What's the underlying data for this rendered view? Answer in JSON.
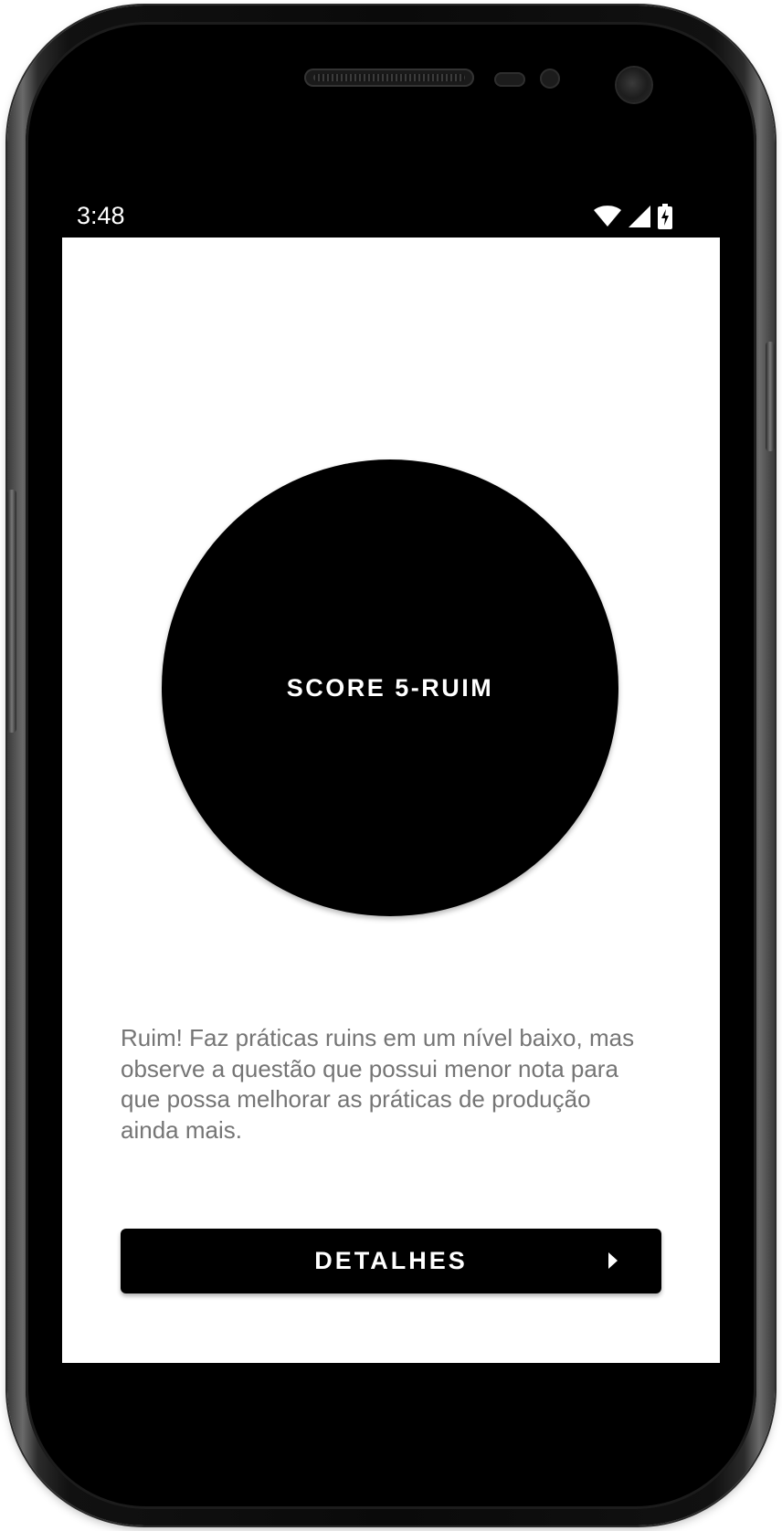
{
  "status_bar": {
    "time": "3:48",
    "icons": [
      "wifi-icon",
      "cell-signal-icon",
      "battery-charging-icon"
    ]
  },
  "score": {
    "label": "SCORE 5-RUIM"
  },
  "description": {
    "text": "Ruim! Faz práticas ruins em um nível baixo, mas observe a questão que possui menor nota para que possa melhorar as práticas de produção ainda mais."
  },
  "details_button": {
    "label": "DETALHES",
    "icon": "arrow-right-icon"
  },
  "colors": {
    "primary": "#000000",
    "background": "#ffffff",
    "text_secondary": "#757575"
  }
}
